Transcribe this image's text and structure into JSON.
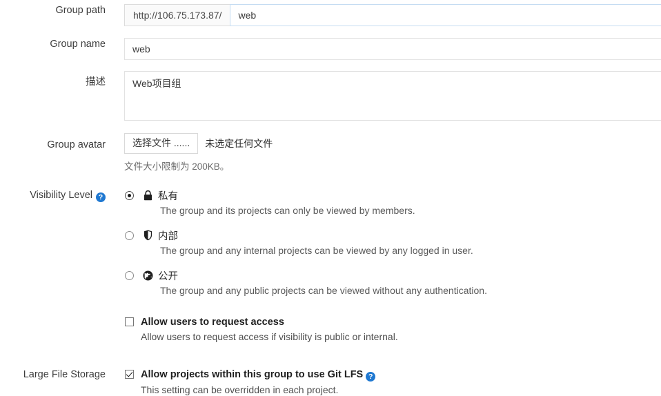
{
  "form": {
    "group_path": {
      "label": "Group path",
      "prefix": "http://106.75.173.87/",
      "value": "web",
      "placeholder": ""
    },
    "group_name": {
      "label": "Group name",
      "value": "web",
      "placeholder": ""
    },
    "description": {
      "label": "描述",
      "value": "Web项目组",
      "placeholder": ""
    },
    "group_avatar": {
      "label": "Group avatar",
      "button_label": "选择文件 ......",
      "status": "未选定任何文件",
      "hint": "文件大小限制为 200KB。"
    },
    "visibility": {
      "label": "Visibility Level",
      "help_glyph": "?",
      "selected": "private",
      "options": [
        {
          "id": "private",
          "icon": "lock-icon",
          "title": "私有",
          "description": "The group and its projects can only be viewed by members.",
          "checked": true
        },
        {
          "id": "internal",
          "icon": "shield-icon",
          "title": "内部",
          "description": "The group and any internal projects can be viewed by any logged in user.",
          "checked": false
        },
        {
          "id": "public",
          "icon": "globe-icon",
          "title": "公开",
          "description": "The group and any public projects can be viewed without any authentication.",
          "checked": false
        }
      ],
      "request_access": {
        "label": "Allow users to request access",
        "description": "Allow users to request access if visibility is public or internal.",
        "checked": false
      }
    },
    "lfs": {
      "label": "Large File Storage",
      "checkbox_label": "Allow projects within this group to use Git LFS",
      "help_glyph": "?",
      "description": "This setting can be overridden in each project.",
      "checked": true
    }
  },
  "colors": {
    "accent": "#1f78d1",
    "focus_border": "#c5dcf2",
    "border": "#e2e2e2",
    "addon_bg": "#fafafa"
  }
}
